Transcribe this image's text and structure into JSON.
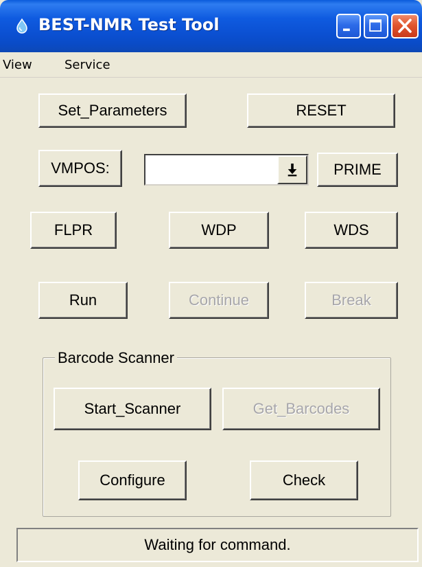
{
  "window": {
    "title": "BEST-NMR Test Tool",
    "titlebar_color": "#0B50D2",
    "close_color": "#E1562E"
  },
  "menu": {
    "items": [
      {
        "label": "View"
      },
      {
        "label": "Service"
      }
    ]
  },
  "buttons": {
    "set_parameters": "Set_Parameters",
    "reset": "RESET",
    "vmpos": "VMPOS:",
    "prime": "PRIME",
    "flpr": "FLPR",
    "wdp": "WDP",
    "wds": "WDS",
    "run": "Run",
    "continue": "Continue",
    "break": "Break"
  },
  "vmpos_combo": {
    "value": ""
  },
  "barcode_scanner": {
    "title": "Barcode Scanner",
    "start_scanner": "Start_Scanner",
    "get_barcodes": "Get_Barcodes",
    "configure": "Configure",
    "check": "Check"
  },
  "status": {
    "text": "Waiting for command."
  },
  "icons": {
    "app": "drop-icon",
    "minimize": "minimize-icon",
    "maximize": "maximize-icon",
    "close": "close-icon",
    "dropdown": "dropdown-arrow-icon"
  }
}
